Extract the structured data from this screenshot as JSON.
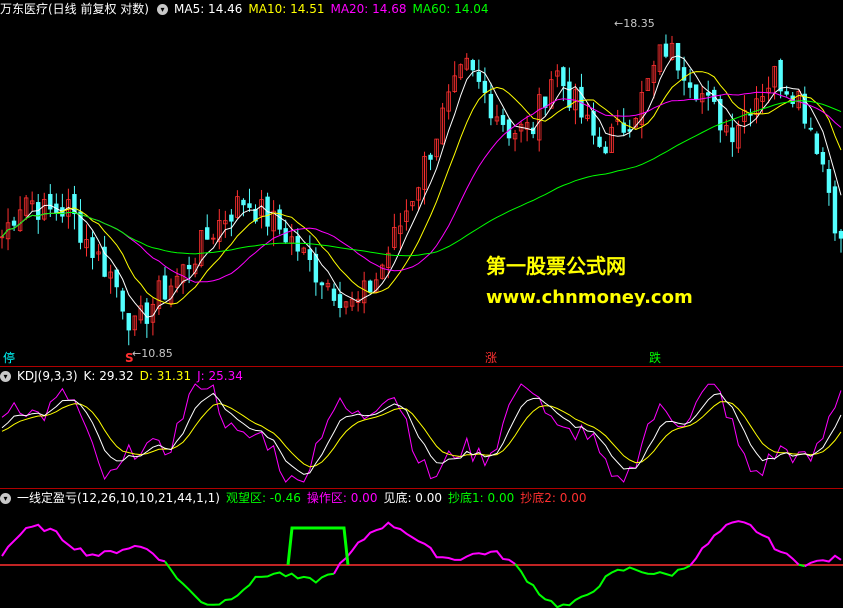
{
  "main": {
    "title": "万东医疗(日线 前复权 对数)",
    "ma": [
      {
        "label": "MA5: 14.46",
        "color": "#ffffff"
      },
      {
        "label": "MA10: 14.51",
        "color": "#ffff00"
      },
      {
        "label": "MA20: 14.68",
        "color": "#ff00ff"
      },
      {
        "label": "MA60: 14.04",
        "color": "#00ff00"
      }
    ],
    "high_label": "18.35",
    "low_label": "10.85",
    "markers": [
      {
        "text": "停",
        "color": "#00ffff"
      },
      {
        "text": "S",
        "color": "#ff3030"
      },
      {
        "text": "涨",
        "color": "#ff3030"
      },
      {
        "text": "跌",
        "color": "#00ff00"
      }
    ]
  },
  "watermark": {
    "line1": "第一股票公式网",
    "line2": "www.chnmoney.com"
  },
  "kdj": {
    "name": "KDJ(9,3,3)",
    "k": "K: 29.32",
    "d": "D: 31.31",
    "j": "J: 25.34",
    "k_color": "#ffffff",
    "d_color": "#ffff00",
    "j_color": "#ff00ff"
  },
  "ind": {
    "name": "一线定盈亏(12,26,10,10,21,44,1,1)",
    "items": [
      {
        "label": "观望区: -0.46",
        "color": "#00ff00"
      },
      {
        "label": "操作区: 0.00",
        "color": "#ff00ff"
      },
      {
        "label": "见底: 0.00",
        "color": "#ffffff"
      },
      {
        "label": "抄底1: 0.00",
        "color": "#00ff00"
      },
      {
        "label": "抄底2: 0.00",
        "color": "#ff3030"
      }
    ]
  },
  "chart_data": [
    {
      "type": "candlestick",
      "title": "万东医疗(日线 前复权 对数)",
      "ylim": [
        10.85,
        18.35
      ],
      "annotations": [
        "18.35",
        "10.85"
      ],
      "close_anchors": [
        13.0,
        13.9,
        13.5,
        13.6,
        12.8,
        12.2,
        11.2,
        11.8,
        12.2,
        12.8,
        13.4,
        13.8,
        13.4,
        13.0,
        12.4,
        12.0,
        11.6,
        12.2,
        13.2,
        14.4,
        15.8,
        17.0,
        16.2,
        15.4,
        15.4,
        17.0,
        16.0,
        15.0,
        15.4,
        16.2,
        17.6,
        17.0,
        16.0,
        15.4,
        16.2,
        16.8,
        16.4,
        15.0,
        12.8
      ],
      "series": [
        {
          "name": "MA5",
          "latest": 14.46,
          "color": "#ffffff"
        },
        {
          "name": "MA10",
          "latest": 14.51,
          "color": "#ffff00"
        },
        {
          "name": "MA20",
          "latest": 14.68,
          "color": "#ff00ff"
        },
        {
          "name": "MA60",
          "latest": 14.04,
          "color": "#00ff00"
        }
      ]
    },
    {
      "type": "line",
      "title": "KDJ(9,3,3)",
      "series": [
        {
          "name": "K",
          "latest": 29.32,
          "color": "#ffffff"
        },
        {
          "name": "D",
          "latest": 31.31,
          "color": "#ffff00"
        },
        {
          "name": "J",
          "latest": 25.34,
          "color": "#ff00ff"
        }
      ]
    },
    {
      "type": "line",
      "title": "一线定盈亏(12,26,10,10,21,44,1,1)",
      "series": [
        {
          "name": "观望区",
          "latest": -0.46,
          "color": "#00ff00"
        },
        {
          "name": "操作区",
          "latest": 0.0,
          "color": "#ff00ff"
        },
        {
          "name": "见底",
          "latest": 0.0,
          "color": "#ffffff"
        },
        {
          "name": "抄底1",
          "latest": 0.0,
          "color": "#00ff00"
        },
        {
          "name": "抄底2",
          "latest": 0.0,
          "color": "#ff3030"
        }
      ]
    }
  ]
}
